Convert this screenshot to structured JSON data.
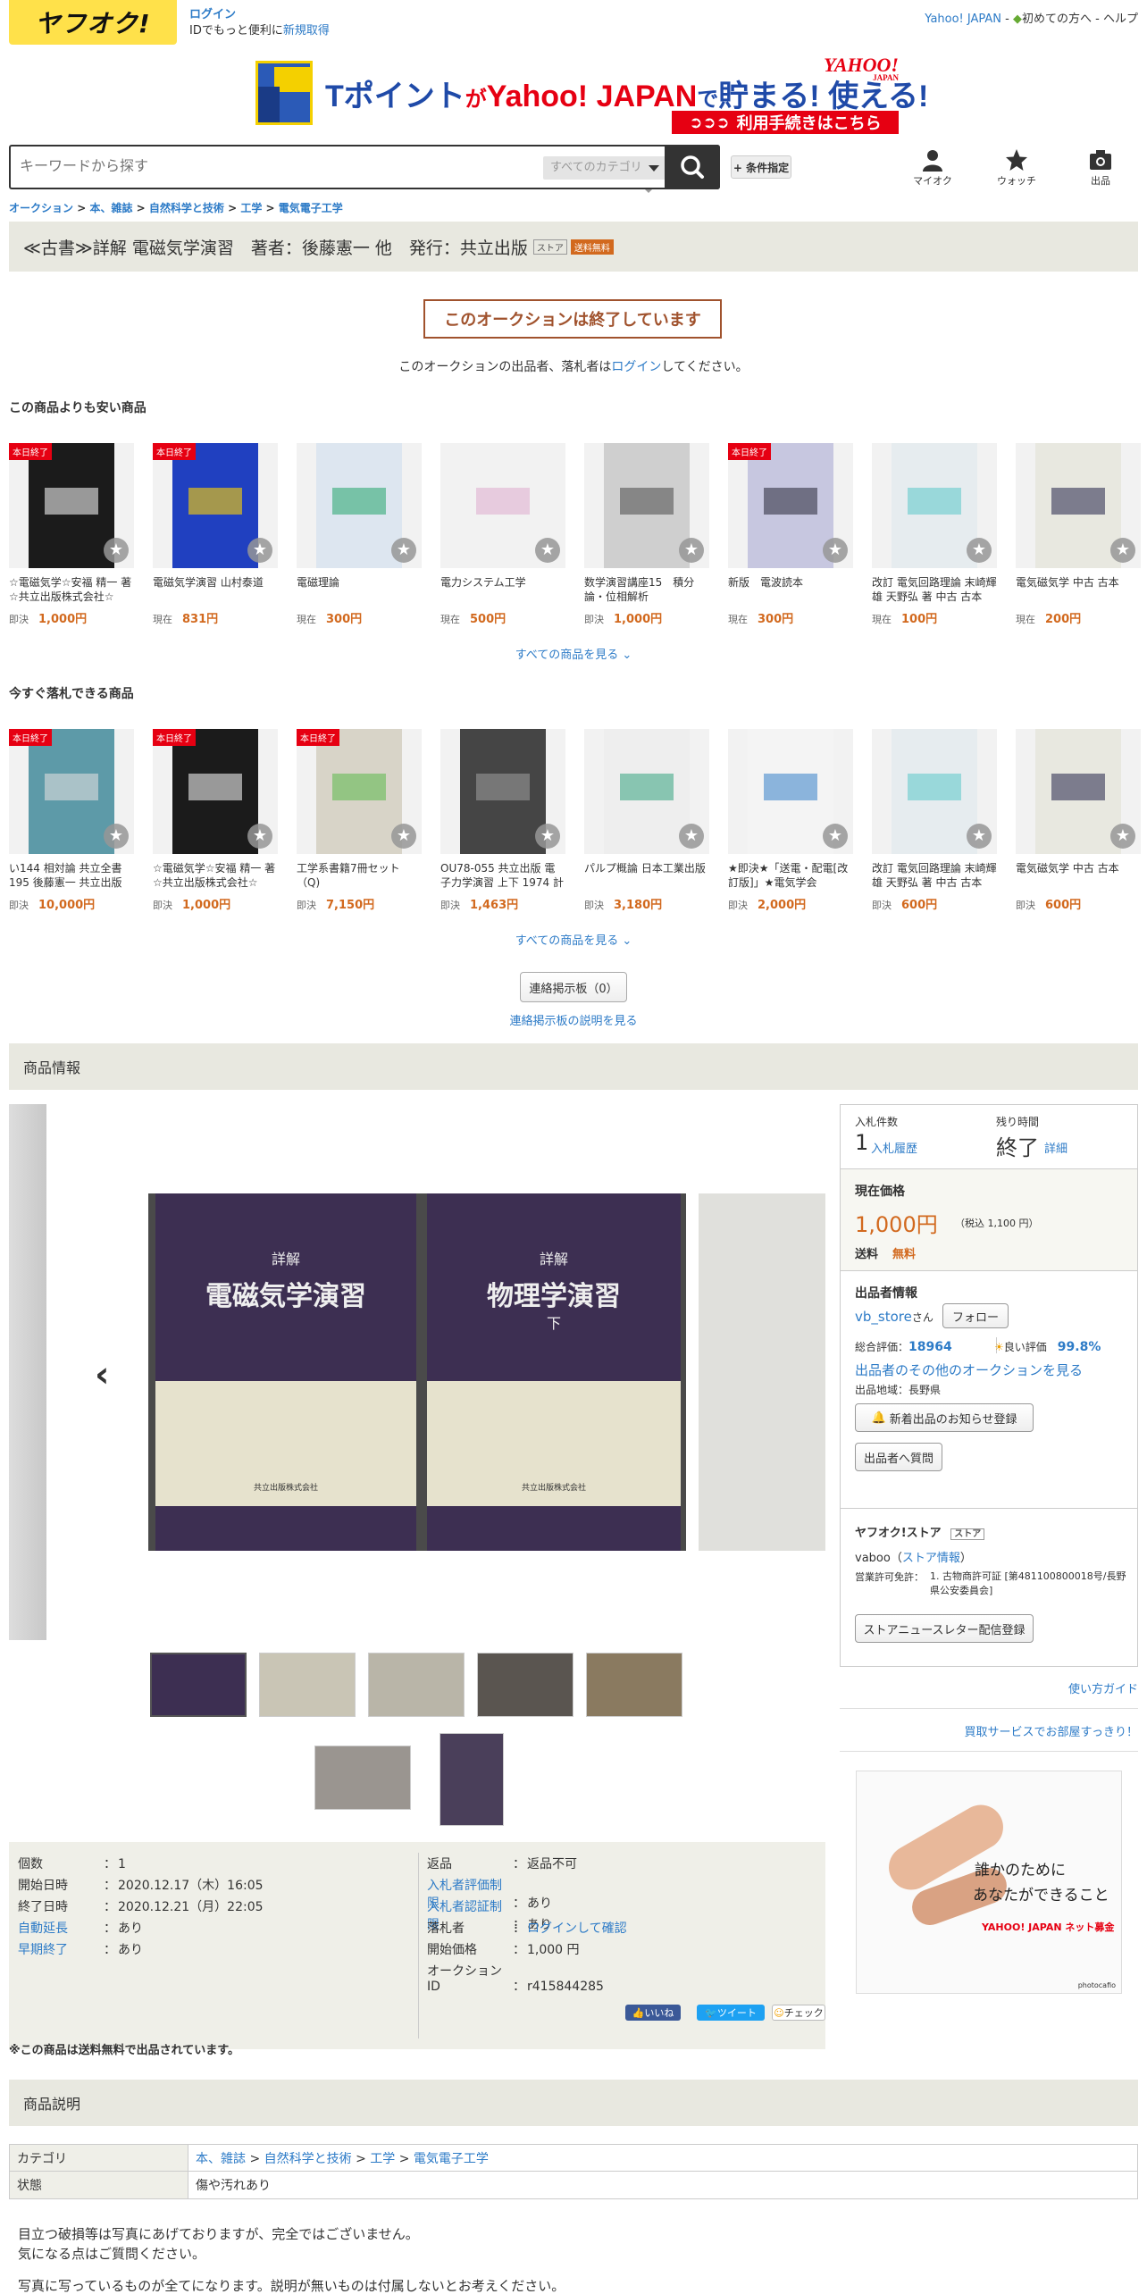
{
  "header": {
    "logo": "ヤフオク!",
    "login": "ログイン",
    "login_sub": "IDでもっと便利に",
    "register": "新規取得",
    "yahoo_japan": "Yahoo! JAPAN",
    "first_time": "初めての方へ",
    "help": "ヘルプ"
  },
  "banner": {
    "text_a": "Tポイント",
    "text_b": "が",
    "text_c": "Yahoo! JAPAN",
    "text_d": "で",
    "text_e": "貯まる! 使える!",
    "yahoo_logo": "YAHOO!",
    "yahoo_logo_sub": "JAPAN",
    "button": "利用手続きはこちら"
  },
  "search": {
    "placeholder": "キーワードから探す",
    "category": "すべてのカテゴリ",
    "conditions": "+ 条件指定"
  },
  "nav_icons": {
    "myauc": "マイオク",
    "watch": "ウォッチ",
    "sell": "出品"
  },
  "breadcrumb": [
    "オークション",
    "本、雑誌",
    "自然科学と技術",
    "工学",
    "電気電子工学"
  ],
  "title": {
    "text": "≪古書≫詳解 電磁気学演習　著者：後藤憲一 他　発行：共立出版",
    "store_badge": "ストア",
    "free_badge": "送料無料"
  },
  "ended": {
    "box": "このオークションは終了しています",
    "msg_a": "このオークションの出品者、落札者は",
    "msg_login": "ログイン",
    "msg_b": "してください。"
  },
  "cheaper": {
    "title": "この商品よりも安い商品",
    "items": [
      {
        "tag": "本日終了",
        "name": "☆電磁気学☆安福 精一 著☆共立出版株式会社☆",
        "price_label": "即決",
        "price": "1,000円"
      },
      {
        "tag": "本日終了",
        "name": "電磁気学演習 山村泰道",
        "price_label": "現在",
        "price": "831円"
      },
      {
        "tag": "",
        "name": "電磁理論",
        "price_label": "現在",
        "price": "300円"
      },
      {
        "tag": "",
        "name": "電力システム工学",
        "price_label": "現在",
        "price": "500円"
      },
      {
        "tag": "",
        "name": "数学演習講座15　積分論・位相解析",
        "price_label": "即決",
        "price": "1,000円"
      },
      {
        "tag": "本日終了",
        "name": "新版　電波読本",
        "price_label": "現在",
        "price": "300円"
      },
      {
        "tag": "",
        "name": "改訂 電気回路理論 末崎輝雄 天野弘 著 中古 古本",
        "price_label": "現在",
        "price": "100円"
      },
      {
        "tag": "",
        "name": "電気磁気学 中古 古本",
        "price_label": "現在",
        "price": "200円"
      }
    ],
    "see_all": "すべての商品を見る"
  },
  "buynow": {
    "title": "今すぐ落札できる商品",
    "items": [
      {
        "tag": "本日終了",
        "name": "い144 相対論 共立全書 195 後藤憲一 共立出版 昭...",
        "price_label": "即決",
        "price": "10,000円"
      },
      {
        "tag": "本日終了",
        "name": "☆電磁気学☆安福 精一 著☆共立出版株式会社☆",
        "price_label": "即決",
        "price": "1,000円"
      },
      {
        "tag": "本日終了",
        "name": "工学系書籍7冊セット（Q)",
        "price_label": "即決",
        "price": "7,150円"
      },
      {
        "tag": "",
        "name": "OU78-055 共立出版 電子力学演習 上下 1974 計2...",
        "price_label": "即決",
        "price": "1,463円"
      },
      {
        "tag": "",
        "name": "パルプ概論 日本工業出版",
        "price_label": "即決",
        "price": "3,180円"
      },
      {
        "tag": "",
        "name": "★即決★「送電・配電[改訂版]」★電気学会",
        "price_label": "即決",
        "price": "2,000円"
      },
      {
        "tag": "",
        "name": "改訂 電気回路理論 末崎輝雄 天野弘 著 中古 古本",
        "price_label": "即決",
        "price": "600円"
      },
      {
        "tag": "",
        "name": "電気磁気学 中古 古本",
        "price_label": "即決",
        "price": "600円"
      }
    ],
    "see_all": "すべての商品を見る"
  },
  "board": {
    "button": "連絡掲示板（0）",
    "link": "連絡掲示板の説明を見る"
  },
  "product_info_title": "商品情報",
  "photo": {
    "book1_small": "詳解",
    "book1_title": "電磁気学演習",
    "book2_small": "詳解",
    "book2_title": "物理学演習",
    "book2_vol": "下",
    "publisher": "共立出版株式会社"
  },
  "details": {
    "left": [
      {
        "label": "個数",
        "value": "1",
        "link": false
      },
      {
        "label": "開始日時",
        "value": "2020.12.17（木）16:05",
        "link": false
      },
      {
        "label": "終了日時",
        "value": "2020.12.21（月）22:05",
        "link": false
      },
      {
        "label": "自動延長",
        "value": "あり",
        "link": true
      },
      {
        "label": "早期終了",
        "value": "あり",
        "link": true
      }
    ],
    "right": [
      {
        "label": "返品",
        "value": "返品不可",
        "link": false
      },
      {
        "label": "入札者評価制限",
        "value": "あり",
        "link": true
      },
      {
        "label": "入札者認証制限",
        "value": "あり",
        "link": true
      },
      {
        "label": "落札者",
        "value": "ログインして確認",
        "link": false,
        "value_link": true
      },
      {
        "label": "開始価格",
        "value": "1,000 円",
        "link": false
      },
      {
        "label": "オークションID",
        "value": "r415844285",
        "link": false
      }
    ]
  },
  "side": {
    "bids_label": "入札件数",
    "bids": "1",
    "bid_history": "入札履歴",
    "remain_label": "残り時間",
    "remain": "終了",
    "detail": "詳細",
    "price_title": "現在価格",
    "price": "1,000円",
    "price_tax": "（税込 1,100 円）",
    "shipping_label": "送料",
    "shipping": "無料",
    "seller_title": "出品者情報",
    "seller": "vb_store",
    "seller_suffix": "さん",
    "follow": "フォロー",
    "rating_label": "総合評価：",
    "rating": "18964",
    "good_label": "良い評価",
    "good": "99.8%",
    "other_auctions": "出品者のその他のオークションを見る",
    "region": "出品地域：長野県",
    "notify": "新着出品のお知らせ登録",
    "question": "出品者へ質問",
    "store_title": "ヤフオク!ストア",
    "store_badge": "ストア",
    "store_name": "vaboo",
    "store_info": "ストア情報",
    "license_label": "営業許可免許：",
    "license": "1. 古物商許可証 [第481100800018号/長野県公安委員会]",
    "newsletter": "ストアニュースレター配信登録",
    "guide": "使い方ガイド",
    "buyback": "買取サービスでお部屋すっきり！",
    "ad_line1": "誰かのために",
    "ad_line2": "あなたができること",
    "ad_brand": "YAHOO! JAPAN ネット募金",
    "ad_credit": "photocafio"
  },
  "share": {
    "like": "いいね",
    "tweet": "ツイート",
    "check": "チェック"
  },
  "free_note": "※この商品は送料無料で出品されています。",
  "desc_title": "商品説明",
  "desc_table": {
    "category_label": "カテゴリ",
    "category_path": [
      "本、雑誌",
      "自然科学と技術",
      "工学",
      "電気電子工学"
    ],
    "condition_label": "状態",
    "condition": "傷や汚れあり"
  },
  "desc_text": {
    "line1": "目立つ破損等は写真にあげておりますが、完全ではございません。",
    "line2": "気になる点はご質問ください。",
    "line3": "写真に写っているものが全てになります。説明が無いものは付属しないとお考えください。"
  },
  "colors": {
    "brand_yellow": "#ffe14a",
    "link": "#2d7bc7",
    "price": "#d2691e",
    "band": "#e8e8e0"
  }
}
